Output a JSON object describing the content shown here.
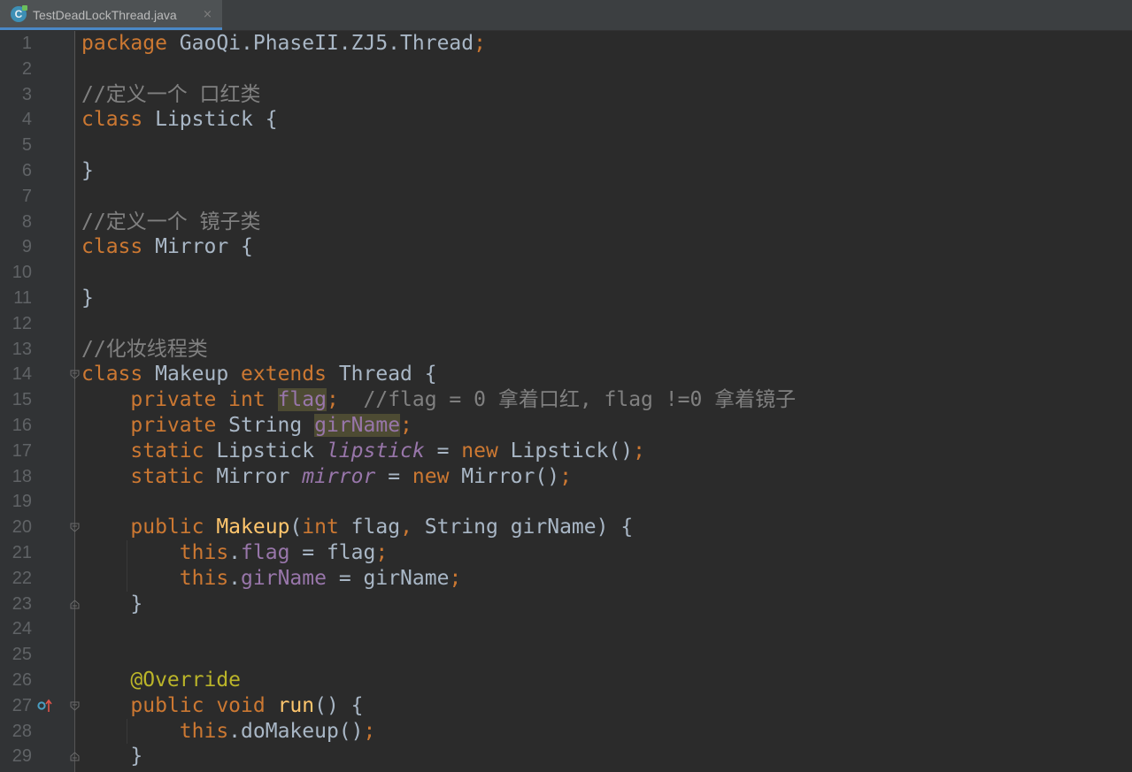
{
  "tab": {
    "file_name": "TestDeadLockThread.java",
    "icon_letter": "C",
    "close_glyph": "×"
  },
  "gutter_markers": {
    "line_27": "overrides-method-icon"
  },
  "colors": {
    "keyword": "#cc7832",
    "plain": "#a9b7c6",
    "comment": "#808080",
    "field": "#9876aa",
    "method": "#ffc66d",
    "annotation": "#bbb529",
    "highlight": "#4d4b33"
  },
  "lines": [
    {
      "no": "1",
      "tokens": [
        {
          "t": "package ",
          "c": "k"
        },
        {
          "t": "GaoQi.PhaseII.ZJ5.Thread",
          "c": "p"
        },
        {
          "t": ";",
          "c": "k"
        }
      ]
    },
    {
      "no": "2",
      "tokens": []
    },
    {
      "no": "3",
      "tokens": [
        {
          "t": "//定义一个 口红类",
          "c": "c"
        }
      ]
    },
    {
      "no": "4",
      "tokens": [
        {
          "t": "class ",
          "c": "k"
        },
        {
          "t": "Lipstick {",
          "c": "p"
        }
      ]
    },
    {
      "no": "5",
      "tokens": []
    },
    {
      "no": "6",
      "tokens": [
        {
          "t": "}",
          "c": "p"
        }
      ]
    },
    {
      "no": "7",
      "tokens": []
    },
    {
      "no": "8",
      "tokens": [
        {
          "t": "//定义一个 镜子类",
          "c": "c"
        }
      ]
    },
    {
      "no": "9",
      "tokens": [
        {
          "t": "class ",
          "c": "k"
        },
        {
          "t": "Mirror {",
          "c": "p"
        }
      ]
    },
    {
      "no": "10",
      "tokens": []
    },
    {
      "no": "11",
      "tokens": [
        {
          "t": "}",
          "c": "p"
        }
      ]
    },
    {
      "no": "12",
      "tokens": []
    },
    {
      "no": "13",
      "tokens": [
        {
          "t": "//化妆线程类",
          "c": "c"
        }
      ]
    },
    {
      "no": "14",
      "tokens": [
        {
          "t": "class ",
          "c": "k"
        },
        {
          "t": "Makeup ",
          "c": "p"
        },
        {
          "t": "extends ",
          "c": "k"
        },
        {
          "t": "Thread {",
          "c": "p"
        }
      ]
    },
    {
      "no": "15",
      "tokens": [
        {
          "t": "    private int ",
          "c": "k"
        },
        {
          "t": "flag",
          "c": "f hl"
        },
        {
          "t": ";",
          "c": "k"
        },
        {
          "t": "  //flag = 0 拿着口红, flag !=0 拿着镜子",
          "c": "c"
        }
      ]
    },
    {
      "no": "16",
      "tokens": [
        {
          "t": "    private ",
          "c": "k"
        },
        {
          "t": "String ",
          "c": "p"
        },
        {
          "t": "girName",
          "c": "f hl"
        },
        {
          "t": ";",
          "c": "k"
        }
      ]
    },
    {
      "no": "17",
      "tokens": [
        {
          "t": "    static ",
          "c": "k"
        },
        {
          "t": "Lipstick ",
          "c": "p"
        },
        {
          "t": "lipstick",
          "c": "sf"
        },
        {
          "t": " = ",
          "c": "p"
        },
        {
          "t": "new ",
          "c": "k"
        },
        {
          "t": "Lipstick()",
          "c": "p"
        },
        {
          "t": ";",
          "c": "k"
        }
      ]
    },
    {
      "no": "18",
      "tokens": [
        {
          "t": "    static ",
          "c": "k"
        },
        {
          "t": "Mirror ",
          "c": "p"
        },
        {
          "t": "mirror",
          "c": "sf"
        },
        {
          "t": " = ",
          "c": "p"
        },
        {
          "t": "new ",
          "c": "k"
        },
        {
          "t": "Mirror()",
          "c": "p"
        },
        {
          "t": ";",
          "c": "k"
        }
      ]
    },
    {
      "no": "19",
      "tokens": []
    },
    {
      "no": "20",
      "tokens": [
        {
          "t": "    public ",
          "c": "k"
        },
        {
          "t": "Makeup",
          "c": "m"
        },
        {
          "t": "(",
          "c": "p"
        },
        {
          "t": "int ",
          "c": "k"
        },
        {
          "t": "flag",
          "c": "p"
        },
        {
          "t": ", ",
          "c": "k"
        },
        {
          "t": "String girName) {",
          "c": "p"
        }
      ]
    },
    {
      "no": "21",
      "tokens": [
        {
          "t": "        this",
          "c": "k"
        },
        {
          "t": ".",
          "c": "p"
        },
        {
          "t": "flag",
          "c": "f"
        },
        {
          "t": " = flag",
          "c": "p"
        },
        {
          "t": ";",
          "c": "k"
        }
      ]
    },
    {
      "no": "22",
      "tokens": [
        {
          "t": "        this",
          "c": "k"
        },
        {
          "t": ".",
          "c": "p"
        },
        {
          "t": "girName",
          "c": "f"
        },
        {
          "t": " = girName",
          "c": "p"
        },
        {
          "t": ";",
          "c": "k"
        }
      ]
    },
    {
      "no": "23",
      "tokens": [
        {
          "t": "    }",
          "c": "p"
        }
      ]
    },
    {
      "no": "24",
      "tokens": []
    },
    {
      "no": "25",
      "tokens": []
    },
    {
      "no": "26",
      "tokens": [
        {
          "t": "    @Override",
          "c": "a"
        }
      ]
    },
    {
      "no": "27",
      "tokens": [
        {
          "t": "    public void ",
          "c": "k"
        },
        {
          "t": "run",
          "c": "m"
        },
        {
          "t": "() {",
          "c": "p"
        }
      ]
    },
    {
      "no": "28",
      "tokens": [
        {
          "t": "        this",
          "c": "k"
        },
        {
          "t": ".",
          "c": "p"
        },
        {
          "t": "doMakeup()",
          "c": "p"
        },
        {
          "t": ";",
          "c": "k"
        }
      ]
    },
    {
      "no": "29",
      "tokens": [
        {
          "t": "    }",
          "c": "p"
        }
      ]
    }
  ]
}
